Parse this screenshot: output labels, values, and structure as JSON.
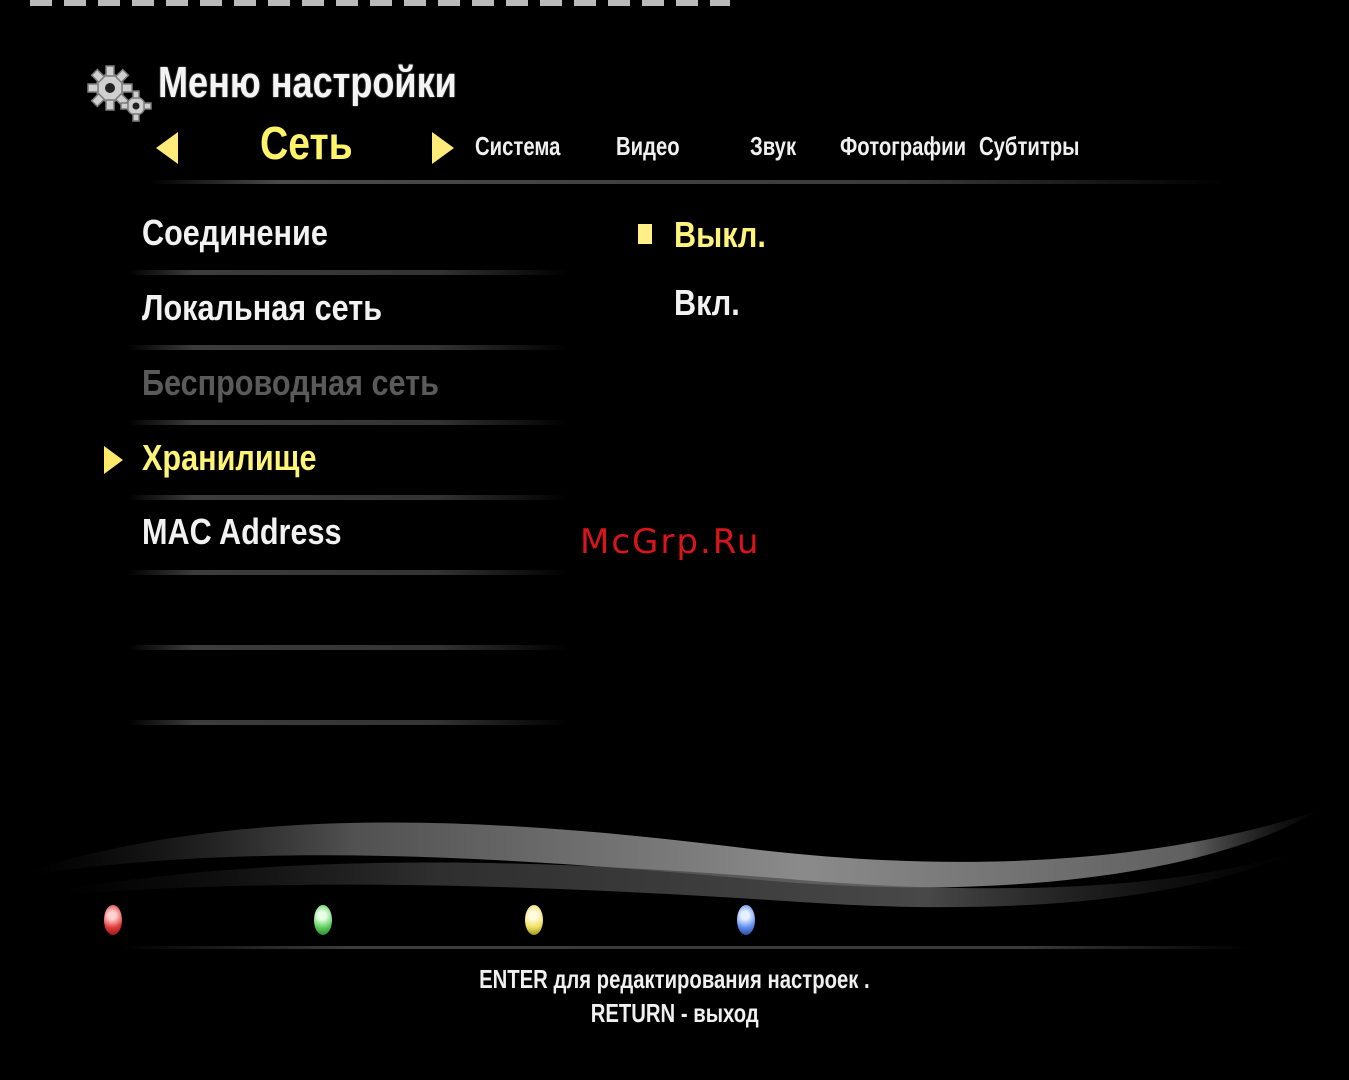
{
  "header": {
    "title": "Меню настройки",
    "icon": "gear-icon"
  },
  "tabs": {
    "active": "Сеть",
    "others": [
      "Система",
      "Видео",
      "Звук",
      "Фотографии",
      "Субтитры"
    ]
  },
  "settings_menu": {
    "items": [
      {
        "label": "Соединение",
        "state": "normal"
      },
      {
        "label": "Локальная сеть",
        "state": "normal"
      },
      {
        "label": "Беспроводная сеть",
        "state": "disabled"
      },
      {
        "label": "Хранилище",
        "state": "selected"
      },
      {
        "label": "MAC Address",
        "state": "normal"
      }
    ]
  },
  "options": {
    "items": [
      {
        "label": "Выкл.",
        "selected": true
      },
      {
        "label": "Вкл.",
        "selected": false
      }
    ]
  },
  "watermark": "McGrp.Ru",
  "color_buttons": [
    {
      "color": "#e23c3c"
    },
    {
      "color": "#5fd05f"
    },
    {
      "color": "#f0e060"
    },
    {
      "color": "#5f8ff0"
    }
  ],
  "footer": {
    "line1": "ENTER для редактирования настроек .",
    "line2": "RETURN - выход"
  }
}
